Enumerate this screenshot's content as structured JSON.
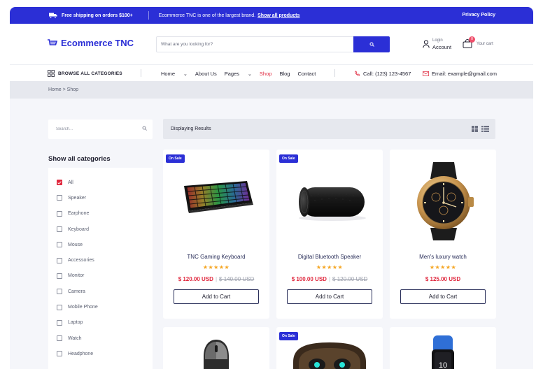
{
  "topbar": {
    "shipping": "Free shipping on orders $100+",
    "promo_text": "Ecommerce TNC is one of the largest brand.",
    "promo_link": "Show all products",
    "privacy": "Privacy Policy"
  },
  "header": {
    "logo": "Ecommerce TNC",
    "search_placeholder": "What are you looking for?",
    "login": "Login",
    "account": "Account",
    "cart_count": "0",
    "cart_label": "Your cart"
  },
  "nav": {
    "categories_label": "BROWSE ALL CATEGORIES",
    "links": [
      {
        "label": "Home",
        "chevron": "⌄"
      },
      {
        "label": "About Us",
        "chevron": ""
      },
      {
        "label": "Pages",
        "chevron": "⌄"
      },
      {
        "label": "Shop",
        "chevron": ""
      },
      {
        "label": "Blog",
        "chevron": ""
      },
      {
        "label": "Contact",
        "chevron": ""
      }
    ],
    "call": "Call: (123) 123-4567",
    "email": "Email: example@gmail.com"
  },
  "breadcrumb": "Home > Shop",
  "sidebar": {
    "search_placeholder": "Search...",
    "title": "Show all categories",
    "categories": [
      "All",
      "Speaker",
      "Earphone",
      "Keyboard",
      "Mouse",
      "Accessories",
      "Monitor",
      "Camera",
      "Mobile Phone",
      "Laptop",
      "Watch",
      "Headphone"
    ]
  },
  "results": {
    "label": "Displaying Results"
  },
  "products": [
    {
      "badge": "On Sale",
      "name": "TNC Gaming Keyboard",
      "stars": "★★★★★",
      "price": "$ 120.00 USD",
      "old_price": "$ 140.00 USD",
      "button": "Add to Cart"
    },
    {
      "badge": "On Sale",
      "name": "Digital Bluetooth Speaker",
      "stars": "★★★★★",
      "price": "$ 100.00 USD",
      "old_price": "$ 120.00 USD",
      "button": "Add to Cart"
    },
    {
      "badge": "",
      "name": "Men's luxury watch",
      "stars": "★★★★★",
      "price": "$ 125.00 USD",
      "old_price": "",
      "button": "Add to Cart"
    },
    {
      "badge": "",
      "name": "",
      "stars": "",
      "price": "",
      "old_price": "",
      "button": ""
    },
    {
      "badge": "On Sale",
      "name": "",
      "stars": "",
      "price": "",
      "old_price": "",
      "button": ""
    },
    {
      "badge": "",
      "name": "",
      "stars": "",
      "price": "",
      "old_price": "",
      "button": ""
    }
  ],
  "colors": {
    "brand": "#2b2fd6",
    "accent": "#e0283e",
    "star": "#f5a623"
  }
}
